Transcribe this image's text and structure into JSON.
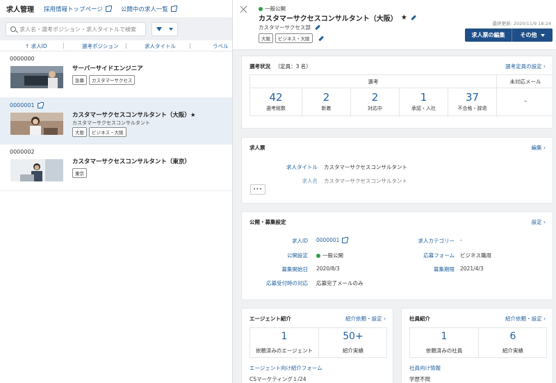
{
  "topbar": {
    "title": "求人管理",
    "link1": "採用情報トップページ",
    "link2": "公開中の求人一覧"
  },
  "search": {
    "placeholder": "求人名・選考ポジション・求人タイトルで検索"
  },
  "columns": {
    "id": "↑ 求人ID",
    "position": "選考ポジション",
    "title": "求人タイトル",
    "label": "ラベル",
    "sep": "|"
  },
  "jobs": [
    {
      "id": "0000000",
      "title": "サーバーサイドエンジニア",
      "subtitle": "",
      "tags": [
        "急募",
        "カスタマーサクセス"
      ]
    },
    {
      "id": "0000001",
      "title": "カスタマーサクセスコンサルタント（大阪）★",
      "subtitle": "カスタマーサクセスコンサルタント",
      "tags": [
        "大阪",
        "ビジネス・大阪"
      ]
    },
    {
      "id": "0000002",
      "title": "カスタマーサクセスコンサルタント（東京）",
      "subtitle": "",
      "tags": [
        "東京"
      ]
    }
  ],
  "detail": {
    "status": "一般公開",
    "title": "カスタマーサクセスコンサルタント（大阪）",
    "star": "★",
    "department": "カスタマーサクセス部",
    "tags": [
      "大阪",
      "ビジネス・大阪"
    ],
    "updated": "最終更新: 2020/11/9 18:24",
    "edit_button": "求人票の編集",
    "other_button": "その他"
  },
  "selection": {
    "heading": "選考状況",
    "capacity": "（定員：3 名）",
    "link": "選考定員の設定",
    "group_label": "選考",
    "unhandled_label": "未対応メール",
    "unhandled_value": "–",
    "stats": [
      {
        "value": "42",
        "label": "選考総数"
      },
      {
        "value": "2",
        "label": "新着"
      },
      {
        "value": "2",
        "label": "対応中"
      },
      {
        "value": "1",
        "label": "承認・入社"
      },
      {
        "value": "37",
        "label": "不合格・辞退"
      }
    ]
  },
  "jobsheet": {
    "heading": "求人票",
    "link": "編集",
    "title_label": "求人タイトル",
    "title_value": "カスタマーサクセスコンサルタント",
    "name_label": "求人名",
    "name_value": "カスタマーサクセスコンサルタント",
    "more": "···"
  },
  "publish": {
    "heading": "公開・募集設定",
    "link": "設定",
    "id_label": "求人ID",
    "id_value": "0000001",
    "category_label": "求人カテゴリー",
    "category_value": "-",
    "setting_label": "公開設定",
    "setting_value": "一般公開",
    "form_label": "応募フォーム",
    "form_value": "ビジネス職用",
    "start_label": "募集開始日",
    "start_value": "2020/8/3",
    "end_label": "募集期限",
    "end_value": "2021/4/3",
    "response_label": "応募受付時の対応",
    "response_value": "応募完了メールのみ"
  },
  "agent": {
    "heading": "エージェント紹介",
    "link": "紹介依頼・設定",
    "count1": "1",
    "label1": "依頼済みのエージェント",
    "count2": "50+",
    "label2": "紹介実績",
    "form_label": "エージェント向け紹介フォーム",
    "form_value": "CSマーケティング１/24"
  },
  "employee": {
    "heading": "社員紹介",
    "link": "紹介依頼・設定",
    "count1": "1",
    "label1": "依頼済みの社員",
    "count2": "6",
    "label2": "紹介実績",
    "info_label": "社員向け情報",
    "info_value": "学歴不問"
  },
  "colors": {
    "accent": "#1f5f9e",
    "button": "#1f4f88",
    "status_green": "#2ea043"
  }
}
